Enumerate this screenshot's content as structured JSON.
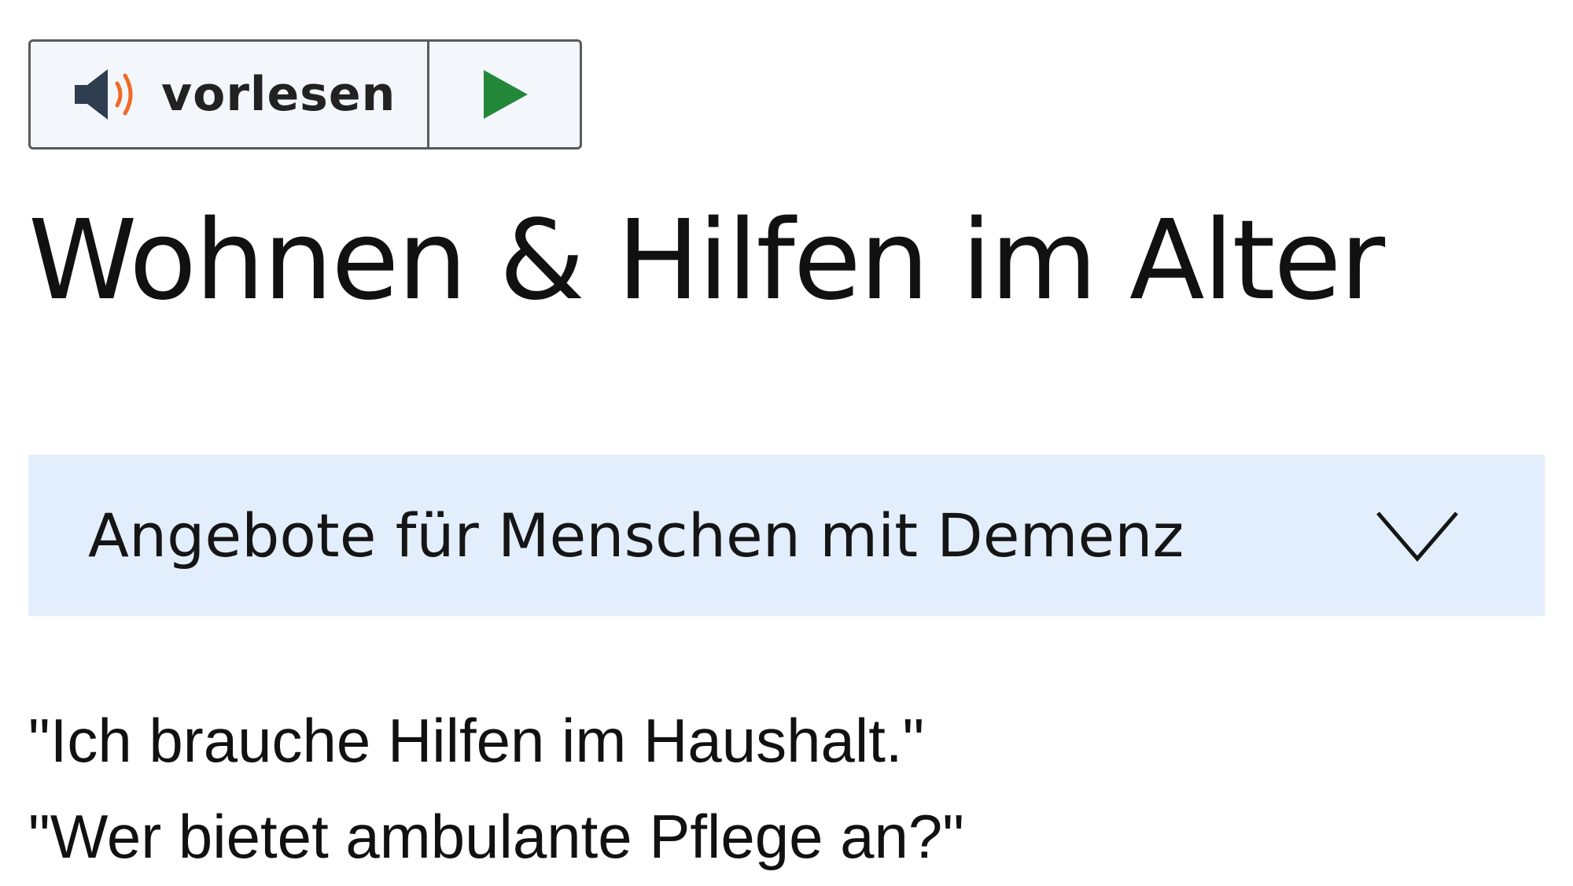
{
  "readspeaker": {
    "listen_label": "vorlesen",
    "speaker_icon": "speaker-icon",
    "play_icon": "play-icon",
    "colors": {
      "speaker": "#2e3d4f",
      "sound_waves": "#f06a25",
      "play": "#23883a",
      "background": "#f3f7fb",
      "border": "#5a5a5a"
    }
  },
  "page": {
    "title": "Wohnen & Hilfen im Alter"
  },
  "accordion": {
    "label": "Angebote für Menschen mit Demenz",
    "icon": "chevron-down-icon",
    "background": "#e2eefb"
  },
  "examples": [
    "\"Ich brauche Hilfen im Haushalt.\"",
    "\"Wer bietet ambulante Pflege an?\""
  ]
}
